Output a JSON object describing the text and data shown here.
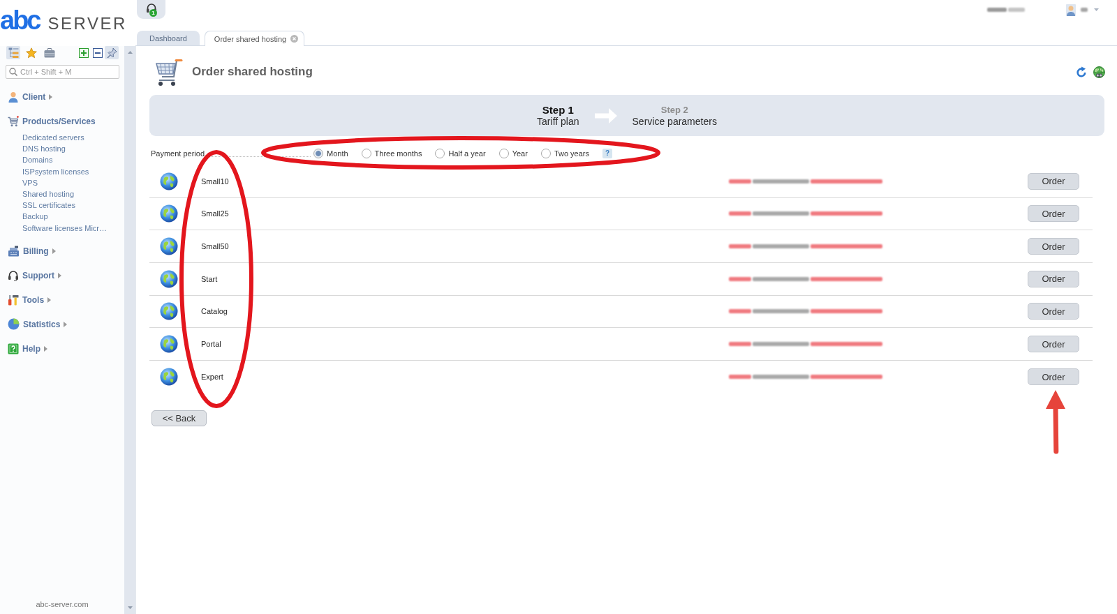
{
  "logo": {
    "mark": "abc",
    "name": "SERVER"
  },
  "support_button": {
    "badge": "1"
  },
  "sidebar": {
    "toolbar": [
      {
        "pressed": true
      },
      {
        "pressed": false
      },
      {
        "pressed": false
      },
      {
        "pressed": false
      },
      {
        "pressed": false
      },
      {
        "pressed": true
      }
    ],
    "search": {
      "placeholder": "Ctrl + Shift + M"
    },
    "menu": [
      {
        "label": "Client",
        "expanded": false
      },
      {
        "label": "Products/Services",
        "expanded": true,
        "children": [
          {
            "label": "Dedicated servers"
          },
          {
            "label": "DNS hosting"
          },
          {
            "label": "Domains"
          },
          {
            "label": "ISPsystem licenses"
          },
          {
            "label": "VPS"
          },
          {
            "label": "Shared hosting"
          },
          {
            "label": "SSL certificates"
          },
          {
            "label": "Backup"
          },
          {
            "label": "Software licenses Micr…"
          }
        ]
      },
      {
        "label": "Billing",
        "expanded": false
      },
      {
        "label": "Support",
        "expanded": false
      },
      {
        "label": "Tools",
        "expanded": false
      },
      {
        "label": "Statistics",
        "expanded": false
      },
      {
        "label": "Help",
        "expanded": false
      }
    ],
    "footer": "abc-server.com"
  },
  "tabs": [
    {
      "label": "Dashboard",
      "selected": false,
      "closable": false
    },
    {
      "label": "Order shared hosting",
      "selected": true,
      "closable": true
    }
  ],
  "page": {
    "title": "Order shared hosting"
  },
  "steps": [
    {
      "number": "Step 1",
      "label": "Tariff plan",
      "selected": true
    },
    {
      "number": "Step 2",
      "label": "Service parameters",
      "selected": false
    }
  ],
  "payment_period": {
    "label": "Payment period",
    "options": [
      {
        "label": "Month",
        "selected": true
      },
      {
        "label": "Three months",
        "selected": false
      },
      {
        "label": "Half a year",
        "selected": false
      },
      {
        "label": "Year",
        "selected": false
      },
      {
        "label": "Two years",
        "selected": false
      }
    ],
    "help": "?"
  },
  "plans": [
    {
      "name": "Small10",
      "action": "Order"
    },
    {
      "name": "Small25",
      "action": "Order"
    },
    {
      "name": "Small50",
      "action": "Order"
    },
    {
      "name": "Start",
      "action": "Order"
    },
    {
      "name": "Catalog",
      "action": "Order"
    },
    {
      "name": "Portal",
      "action": "Order"
    },
    {
      "name": "Expert",
      "action": "Order"
    }
  ],
  "back_button": "<< Back",
  "annotations": [
    {
      "kind": "ellipse"
    },
    {
      "kind": "ellipse"
    },
    {
      "kind": "arrow"
    }
  ]
}
